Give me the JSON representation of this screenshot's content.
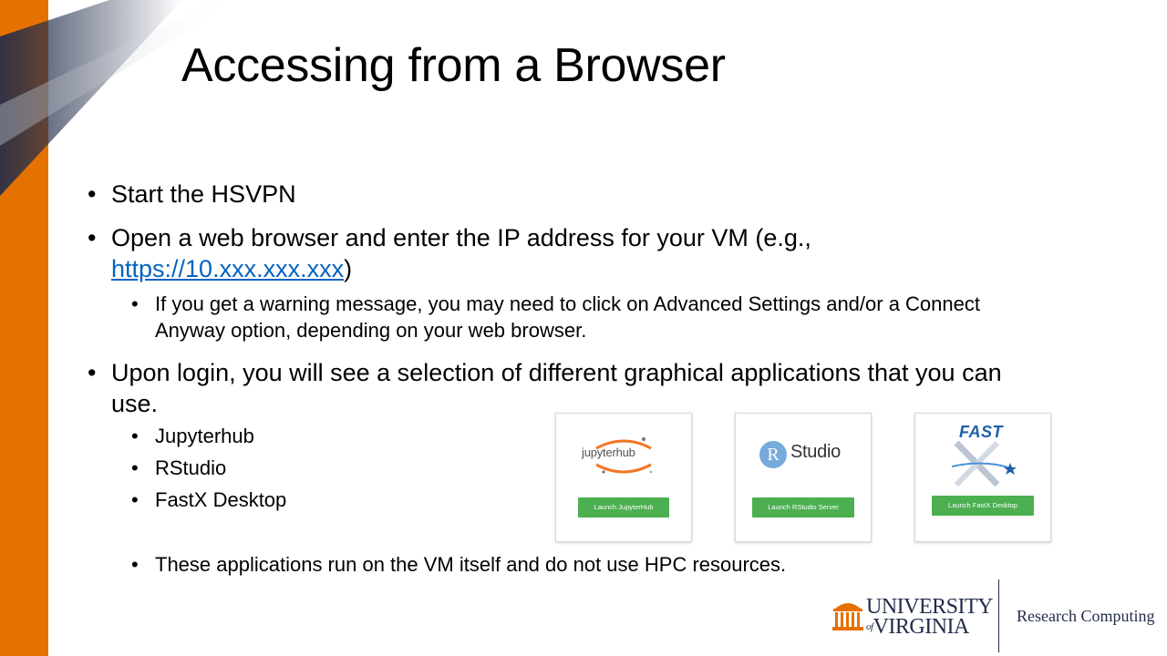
{
  "slide": {
    "title": "Accessing from a Browser",
    "bullets": {
      "start_vpn": "Start the HSVPN",
      "open_browser_prefix": "Open a web browser and enter the IP address for your VM (e.g., ",
      "ip_link": "https://10.xxx.xxx.xxx",
      "open_browser_suffix": ")",
      "warning_note": "If you get a warning message, you may need to click on Advanced Settings and/or a Connect Anyway option, depending on your web browser.",
      "upon_login": "Upon login, you will see a selection of different graphical applications that you can use.",
      "apps": [
        "Jupyterhub",
        "RStudio",
        "FastX Desktop"
      ],
      "hpc_note": "These applications run on the VM itself and do not use HPC resources."
    }
  },
  "cards": {
    "jupyterhub": {
      "logo_text": "jupyterhub",
      "button": "Launch JupyterHub"
    },
    "rstudio": {
      "logo_letter": "R",
      "logo_text": "Studio",
      "button": "Launch RStudio Server"
    },
    "fastx": {
      "logo_text": "FAST",
      "button": "Launch FastX Desktop"
    }
  },
  "footer": {
    "university_line1": "UNIVERSITY",
    "university_of": "of",
    "university_line2": "VIRGINIA",
    "department": "Research Computing"
  },
  "colors": {
    "accent_orange": "#E57200",
    "navy": "#232D4B",
    "link_blue": "#0563C1",
    "launch_green": "#4CAF50"
  }
}
